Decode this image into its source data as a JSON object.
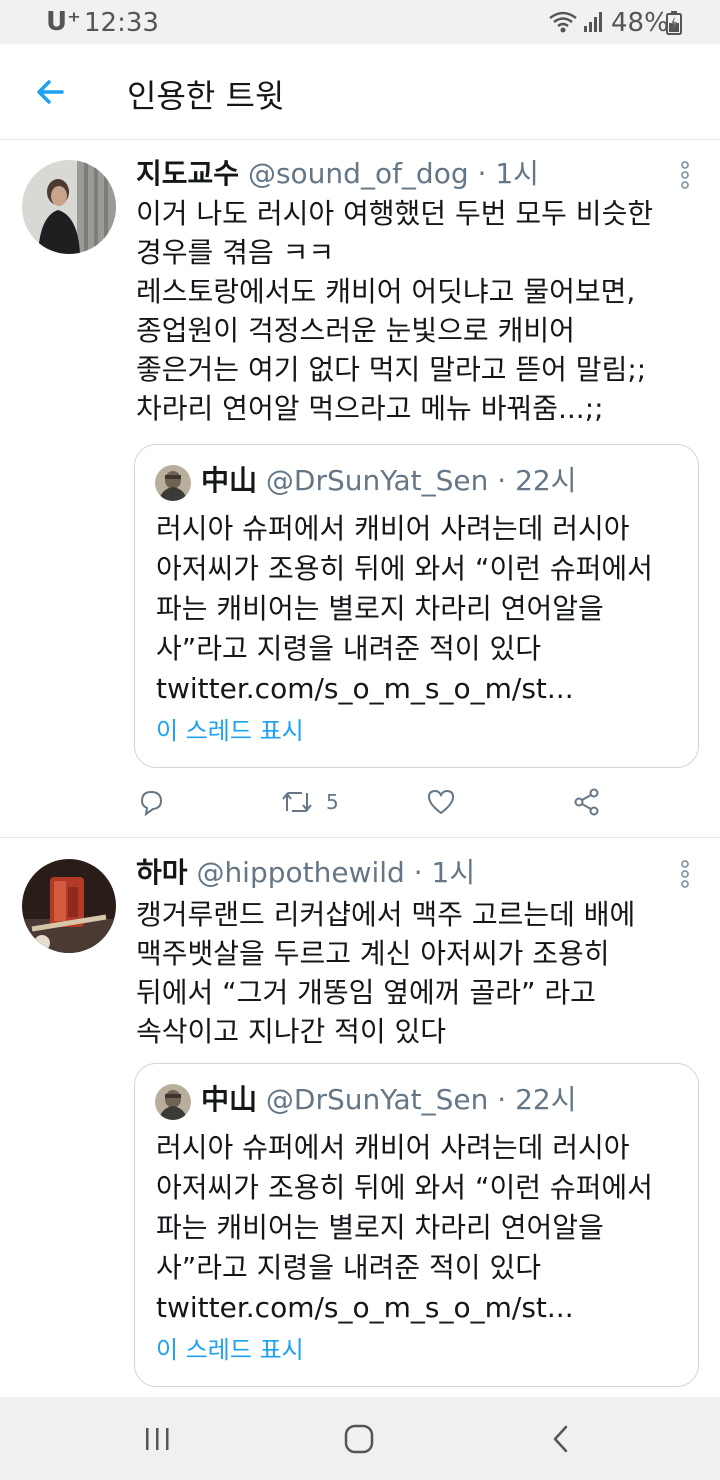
{
  "status_bar": {
    "carrier": "U⁺",
    "time": "12:33",
    "battery": "48%"
  },
  "header": {
    "title": "인용한 트윗",
    "back_icon": "arrow-left-icon"
  },
  "tweets": [
    {
      "author": "지도교수",
      "handle": "@sound_of_dog",
      "sep": " · ",
      "time": "1시",
      "lines": [
        "이거 나도 러시아 여행했던 두번 모두 비슷한",
        "경우를 겪음 ㅋㅋ",
        "레스토랑에서도 캐비어 어딧냐고 물어보면,",
        "종업원이 걱정스러운 눈빛으로 캐비어",
        "좋은거는 여기 없다 먹지 말라고 뜯어 말림;;",
        "차라리 연어알 먹으라고 메뉴 바꿔줌...;;"
      ],
      "retweet_count": "5",
      "quote": {
        "author": "中山",
        "handle": "@DrSunYat_Sen",
        "sep": " · ",
        "time": "22시",
        "lines": [
          "러시아 슈퍼에서 캐비어 사려는데 러시아",
          "아저씨가 조용히 뒤에 와서 “이런 슈퍼에서",
          "파는 캐비어는 별로지 차라리 연어알을",
          "사”라고 지령을 내려준 적이 있다",
          "twitter.com/s_o_m_s_o_m/st..."
        ],
        "thread_link": "이 스레드 표시"
      }
    },
    {
      "author": "하마",
      "handle": "@hippothewild",
      "sep": " · ",
      "time": "1시",
      "lines": [
        "캥거루랜드 리커샵에서 맥주 고르는데 배에",
        "맥주뱃살을 두르고 계신 아저씨가 조용히",
        "뒤에서 “그거 개똥임 옆에꺼 골라” 라고",
        "속삭이고 지나간 적이 있다"
      ],
      "quote": {
        "author": "中山",
        "handle": "@DrSunYat_Sen",
        "sep": " · ",
        "time": "22시",
        "lines": [
          "러시아 슈퍼에서 캐비어 사려는데 러시아",
          "아저씨가 조용히 뒤에 와서 “이런 슈퍼에서",
          "파는 캐비어는 별로지 차라리 연어알을",
          "사”라고 지령을 내려준 적이 있다",
          "twitter.com/s_o_m_s_o_m/st..."
        ],
        "thread_link": "이 스레드 표시"
      }
    }
  ],
  "colors": {
    "accent": "#1da1f2",
    "secondary_text": "#657786",
    "border": "#e1e8ed"
  },
  "nav_bar": {
    "icons": [
      "recent-apps-icon",
      "home-icon",
      "back-icon"
    ]
  }
}
